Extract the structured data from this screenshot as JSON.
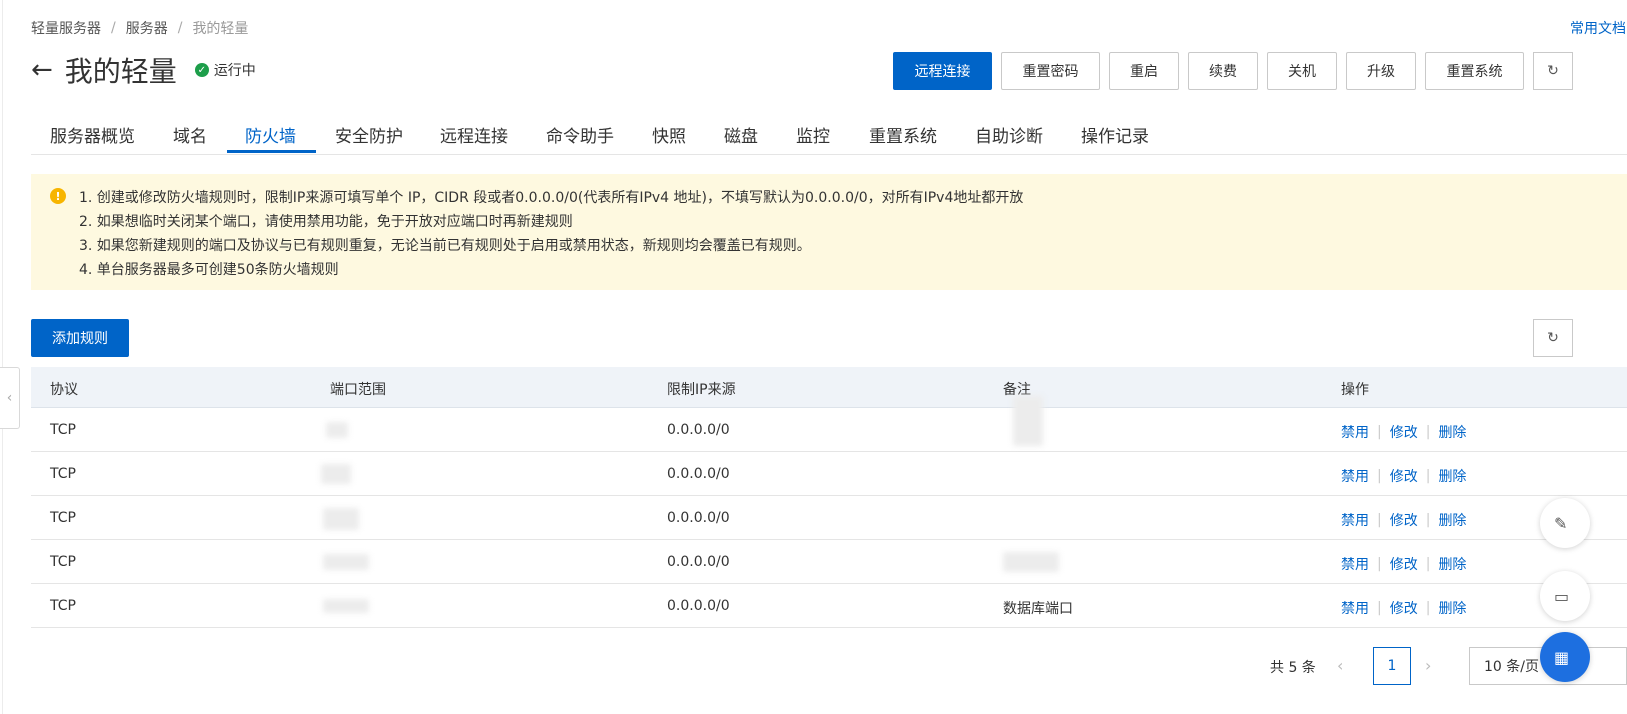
{
  "breadcrumb": [
    "轻量服务器",
    "服务器",
    "我的轻量"
  ],
  "doc_link": "常用文档",
  "page": {
    "title": "我的轻量",
    "status": "运行中",
    "back_icon": "←"
  },
  "actions": [
    "远程连接",
    "重置密码",
    "重启",
    "续费",
    "关机",
    "升级",
    "重置系统"
  ],
  "tabs": [
    "服务器概览",
    "域名",
    "防火墙",
    "安全防护",
    "远程连接",
    "命令助手",
    "快照",
    "磁盘",
    "监控",
    "重置系统",
    "自助诊断",
    "操作记录"
  ],
  "active_tab": "防火墙",
  "notice": [
    "1. 创建或修改防火墙规则时，限制IP来源可填写单个 IP，CIDR 段或者0.0.0.0/0(代表所有IPv4 地址)，不填写默认为0.0.0.0/0，对所有IPv4地址都开放",
    "2. 如果想临时关闭某个端口，请使用禁用功能，免于开放对应端口时再新建规则",
    "3. 如果您新建规则的端口及协议与已有规则重复，无论当前已有规则处于启用或禁用状态，新规则均会覆盖已有规则。",
    "4. 单台服务器最多可创建50条防火墙规则"
  ],
  "add_rule_button": "添加规则",
  "table": {
    "headers": [
      "协议",
      "端口范围",
      "限制IP来源",
      "备注",
      "操作"
    ],
    "rows": [
      {
        "protocol": "TCP",
        "ip_source": "0.0.0.0/0",
        "note": ""
      },
      {
        "protocol": "TCP",
        "ip_source": "0.0.0.0/0",
        "note": ""
      },
      {
        "protocol": "TCP",
        "ip_source": "0.0.0.0/0",
        "note": ""
      },
      {
        "protocol": "TCP",
        "ip_source": "0.0.0.0/0",
        "note": ""
      },
      {
        "protocol": "TCP",
        "ip_source": "0.0.0.0/0",
        "note": "数据库端口"
      }
    ],
    "row_actions": {
      "disable": "禁用",
      "edit": "修改",
      "delete": "删除"
    }
  },
  "pagination": {
    "total": "共 5 条",
    "current_page": "1",
    "page_size": "10 条/页"
  },
  "colors": {
    "primary": "#0064c8",
    "notice_bg": "#fef9e0",
    "status_green": "#1d9e4a",
    "warning": "#f7b500"
  }
}
